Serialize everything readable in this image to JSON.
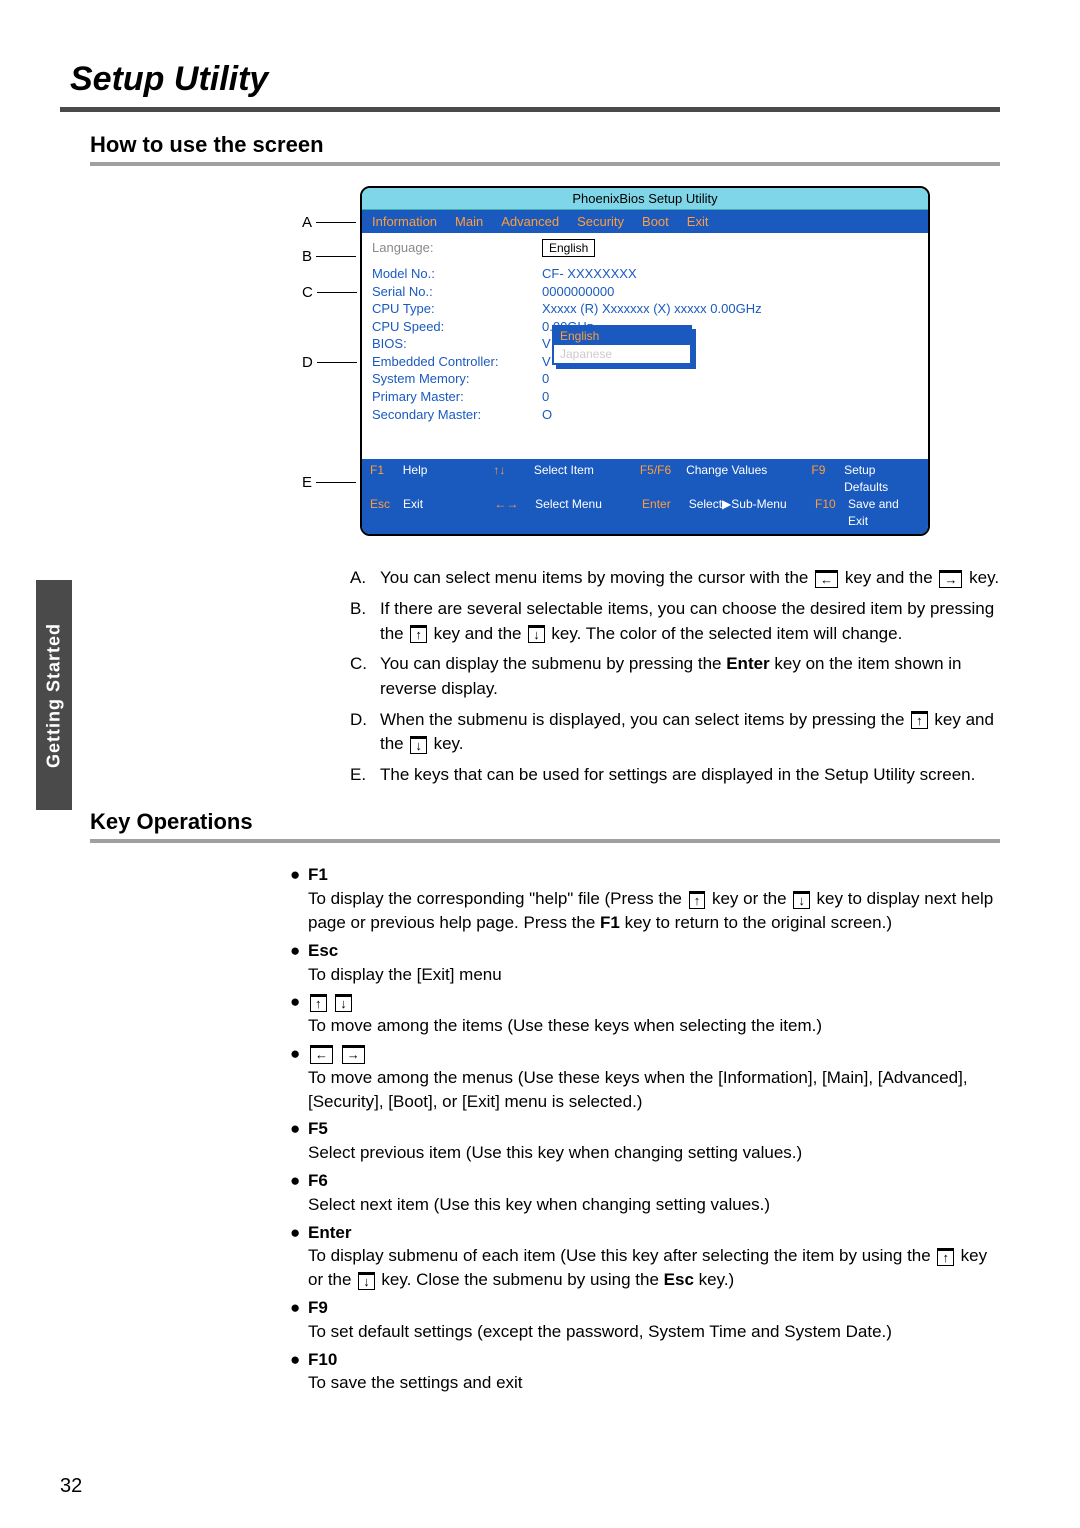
{
  "page_number": "32",
  "title": "Setup Utility",
  "side_tab": "Getting Started",
  "section1": "How to use the screen",
  "section2": "Key Operations",
  "bios": {
    "title": "PhoenixBios Setup Utility",
    "menu": [
      "Information",
      "Main",
      "Advanced",
      "Security",
      "Boot",
      "Exit"
    ],
    "rows": {
      "language_l": "Language:",
      "language_v": "English",
      "model_l": "Model No.:",
      "model_v": "CF- XXXXXXXX",
      "serial_l": "Serial No.:",
      "serial_v": "0000000000",
      "cputype_l": "CPU Type:",
      "cputype_v": "Xxxxx (R) Xxxxxxx (X) xxxxx 0.00GHz",
      "cpuspeed_l": "CPU Speed:",
      "cpuspeed_v": "0.00GHz",
      "bios_l": "BIOS:",
      "bios_v": "V",
      "ec_l": "Embedded Controller:",
      "ec_v": "V",
      "mem_l": "System Memory:",
      "mem_v": "0",
      "pm_l": "Primary Master:",
      "pm_v": "0",
      "sm_l": "Secondary Master:",
      "sm_v": "O"
    },
    "submenu": {
      "sel": "English",
      "opt": "Japanese"
    },
    "footer": {
      "r1": {
        "k1": "F1",
        "v1": "Help",
        "k2": "↑↓",
        "v2": "Select Item",
        "k3": "F5/F6",
        "v3": "Change Values",
        "k4": "F9",
        "v4": "Setup Defaults"
      },
      "r2": {
        "k1": "Esc",
        "v1": "Exit",
        "k2": "←→",
        "v2": "Select Menu",
        "k3": "Enter",
        "v3": "Select▶Sub-Menu",
        "k4": "F10",
        "v4": "Save and Exit"
      }
    }
  },
  "callouts": {
    "A": "A",
    "B": "B",
    "C": "C",
    "D": "D",
    "E": "E"
  },
  "explain": {
    "A": {
      "pre": "You can select menu items by moving the cursor with the ",
      "mid": " key and the ",
      "post": " key."
    },
    "B": {
      "pre": "If there are several selectable items, you can choose the desired item by pressing the ",
      "mid": " key and the ",
      "post": " key.  The color of the selected item will change."
    },
    "C": {
      "pre": "You can display the submenu by pressing the ",
      "key": "Enter",
      "post": " key on the item shown in reverse display."
    },
    "D": {
      "pre": "When the submenu is displayed, you can select items by pressing the ",
      "mid": " key and the ",
      "post": " key."
    },
    "E": "The keys that can be used for settings are displayed in the Setup Utility screen."
  },
  "ops": {
    "F1": {
      "k": "F1",
      "t1": "To display the corresponding \"help\" file (Press the ",
      "t2": " key or the ",
      "t3": " key to display next help page or previous help page. Press the ",
      "k2": "F1",
      "t4": " key to return to the original screen.)"
    },
    "Esc": {
      "k": "Esc",
      "t": "To display the [Exit] menu"
    },
    "UD": {
      "t": "To move among the items (Use these keys when selecting the item.)"
    },
    "LR": {
      "t": "To move among the menus (Use these keys when the [Information], [Main], [Advanced], [Security], [Boot], or [Exit] menu is selected.)"
    },
    "F5": {
      "k": "F5",
      "t": "Select previous item (Use this key when changing setting values.)"
    },
    "F6": {
      "k": "F6",
      "t": "Select next item (Use this key when changing setting values.)"
    },
    "Enter": {
      "k": "Enter",
      "t1": "To display submenu of each item (Use this key after selecting the item by using the ",
      "t2": " key or the ",
      "t3": " key. Close the submenu by using the ",
      "k2": "Esc",
      "t4": " key.)"
    },
    "F9": {
      "k": "F9",
      "t": "To set default settings (except the password, System Time and System Date.)"
    },
    "F10": {
      "k": "F10",
      "t": "To save the settings and exit"
    }
  }
}
